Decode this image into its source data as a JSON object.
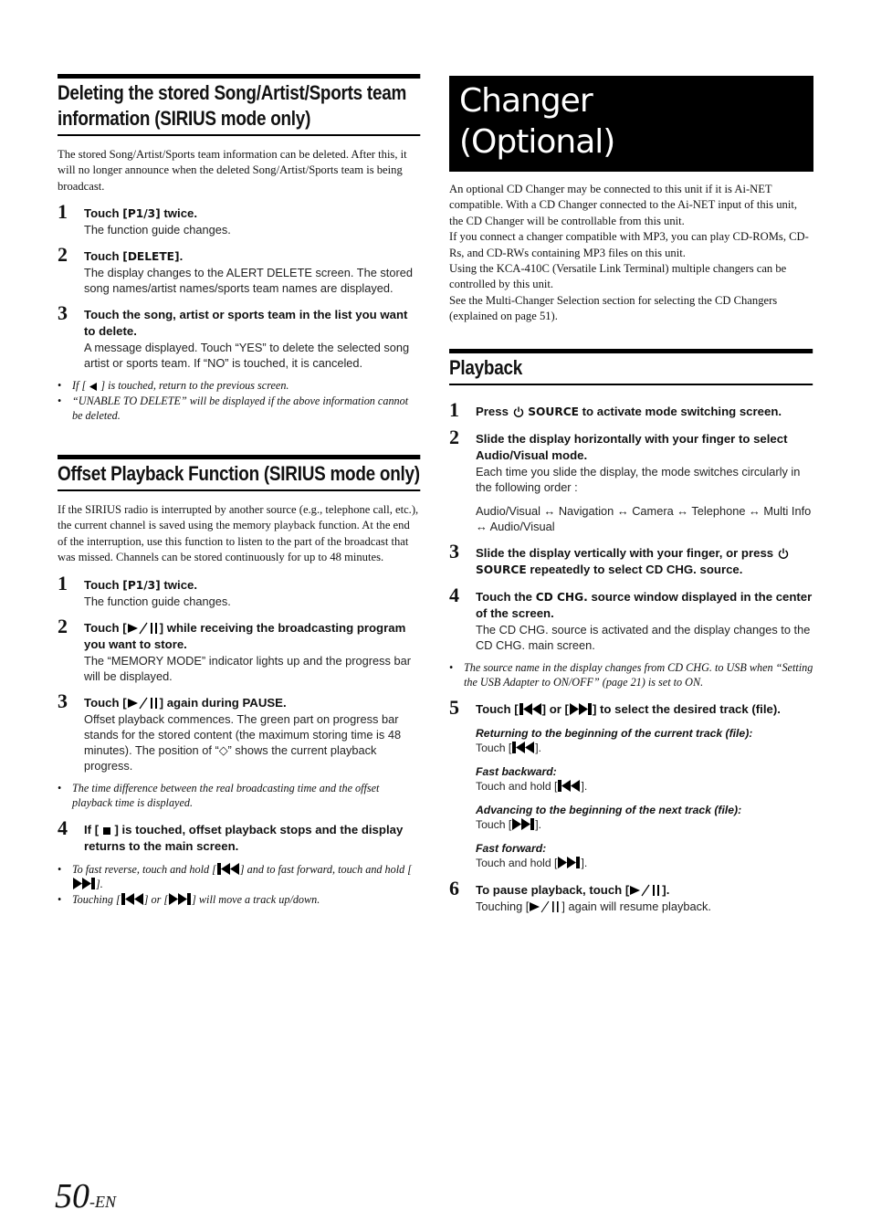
{
  "left": {
    "section1": {
      "heading": "Deleting the stored Song/Artist/Sports team information (SIRIUS mode only)",
      "intro": "The stored Song/Artist/Sports team information can be deleted. After this, it will no longer announce when the deleted Song/Artist/Sports team is being broadcast.",
      "steps": [
        {
          "num": "1",
          "title_pre": "Touch ",
          "title_key": "[P1/3]",
          "title_post": " twice.",
          "body": "The function guide changes."
        },
        {
          "num": "2",
          "title_pre": "Touch ",
          "title_key": "[DELETE]",
          "title_post": ".",
          "body": "The display changes to the ALERT DELETE screen. The stored song names/artist names/sports team names are displayed."
        },
        {
          "num": "3",
          "title": "Touch the song, artist or sports team in the list you want to delete.",
          "body": "A message displayed. Touch “YES” to delete the selected song artist or sports team. If “NO” is touched, it is canceled."
        }
      ],
      "notes": [
        {
          "pre": "If [ ",
          "post": " ] is touched, return to the previous screen."
        },
        {
          "text": "“UNABLE TO DELETE” will be displayed if the above information cannot be deleted."
        }
      ]
    },
    "section2": {
      "heading": "Offset Playback Function (SIRIUS mode only)",
      "intro": "If the SIRIUS radio is interrupted by another source (e.g., telephone call, etc.), the current channel is saved using the memory playback function. At the end of the interruption, use this function to listen to the part of the broadcast that was missed. Channels can be stored continuously for up to 48 minutes.",
      "steps": [
        {
          "num": "1",
          "title_pre": "Touch ",
          "title_key": "[P1/3]",
          "title_post": " twice.",
          "body": "The function guide changes."
        },
        {
          "num": "2",
          "title_pre": "Touch [",
          "title_post": "] while receiving the broadcasting program you want to store.",
          "body": "The “MEMORY MODE” indicator lights up and the progress bar will be displayed."
        },
        {
          "num": "3",
          "title_pre": "Touch [",
          "title_post": "] again during PAUSE.",
          "body": "Offset playback commences. The green part on progress bar stands for the stored content (the maximum storing time is 48 minutes). The position of “◇” shows the current playback progress."
        },
        {
          "num": "4",
          "title_pre": "If [ ",
          "title_post": " ] is touched, offset playback stops and the display returns to the main screen."
        }
      ],
      "note_after_3": "The time difference between the real broadcasting time and the offset playback time is displayed.",
      "notes_end": [
        {
          "a": "To fast reverse, touch and hold [",
          "b": "] and to fast forward, touch and hold [",
          "c": "]."
        },
        {
          "a": "Touching [",
          "b": "] or [",
          "c": "] will move a track up/down."
        }
      ]
    }
  },
  "right": {
    "title_line1": "Changer",
    "title_line2": "(Optional)",
    "intro": [
      "An optional CD Changer may be connected to this unit if it is Ai-NET compatible. With a CD Changer connected to the Ai-NET input of this unit, the CD Changer will be controllable from this unit.",
      "If you connect a changer compatible with MP3, you can play CD-ROMs, CD-Rs, and CD-RWs containing MP3 files on this unit.",
      "Using the KCA-410C (Versatile Link Terminal) multiple changers can be controlled by this unit.",
      "See the Multi-Changer Selection section for selecting the CD Changers (explained on page 51)."
    ],
    "playback": {
      "heading": "Playback",
      "step1": {
        "num": "1",
        "pre": "Press ",
        "key": "SOURCE",
        "post": " to activate mode switching screen."
      },
      "step2": {
        "num": "2",
        "title": "Slide the display horizontally with your finger to select Audio/Visual mode.",
        "body": "Each time you slide the display, the mode switches circularly in the following order :",
        "order": "Audio/Visual ↔ Navigation ↔ Camera ↔ Telephone ↔ Multi Info ↔ Audio/Visual"
      },
      "step3": {
        "num": "3",
        "pre": "Slide the display vertically with your finger, or press ",
        "key": "SOURCE",
        "post": " repeatedly to select CD CHG. source."
      },
      "step4": {
        "num": "4",
        "pre": "Touch the ",
        "key": "CD CHG.",
        "post": " source window displayed in the center of the screen.",
        "body": "The CD CHG. source is activated and the display changes to the CD CHG. main screen."
      },
      "note4": "The source name in the display changes from CD CHG. to USB when “Setting the USB Adapter to ON/OFF” (page 21) is set to ON.",
      "step5": {
        "num": "5",
        "a": "Touch [",
        "b": "] or [",
        "c": "] to select the desired track (file).",
        "subs": [
          {
            "title": "Returning to the beginning of the current track (file):",
            "text": "Touch [",
            "icon": "prev",
            "end": "]."
          },
          {
            "title": "Fast backward:",
            "text": "Touch and hold [",
            "icon": "prev",
            "end": "]."
          },
          {
            "title": "Advancing to the beginning of the next track (file):",
            "text": "Touch [",
            "icon": "next",
            "end": "]."
          },
          {
            "title": "Fast forward:",
            "text": "Touch and hold [",
            "icon": "next",
            "end": "]."
          }
        ]
      },
      "step6": {
        "num": "6",
        "pre": "To pause playback, touch [",
        "post": "].",
        "body_pre": "Touching [",
        "body_post": "] again will resume playback."
      }
    }
  },
  "footer": {
    "page": "50",
    "suffix": "-EN"
  }
}
